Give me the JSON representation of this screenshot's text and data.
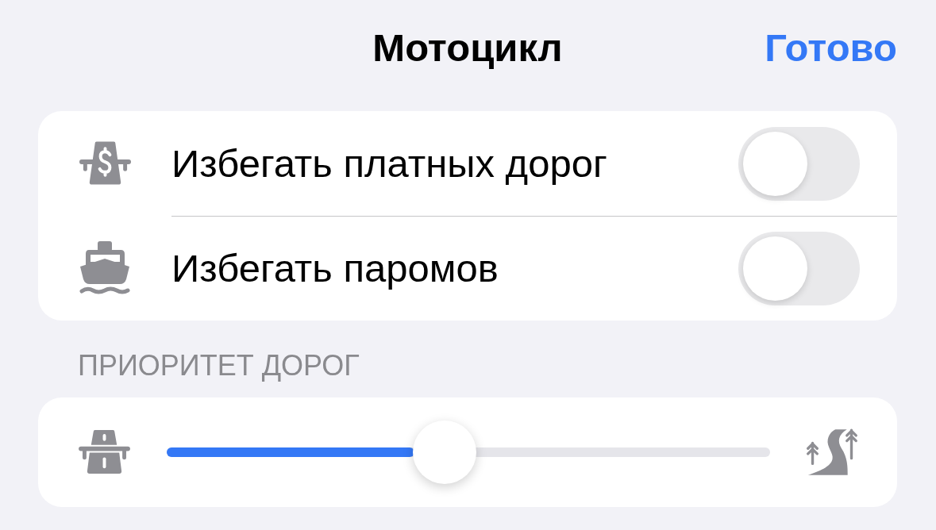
{
  "navigation": {
    "title": "Мотоцикл",
    "done_button": "Готово"
  },
  "avoid_options": [
    {
      "kind": "toll",
      "label": "Избегать платных дорог",
      "on": false
    },
    {
      "kind": "ferry",
      "label": "Избегать паромов",
      "on": false
    }
  ],
  "road_priority": {
    "header": "ПРИОРИТЕТ ДОРОГ",
    "slider": {
      "level": 0.46
    }
  }
}
